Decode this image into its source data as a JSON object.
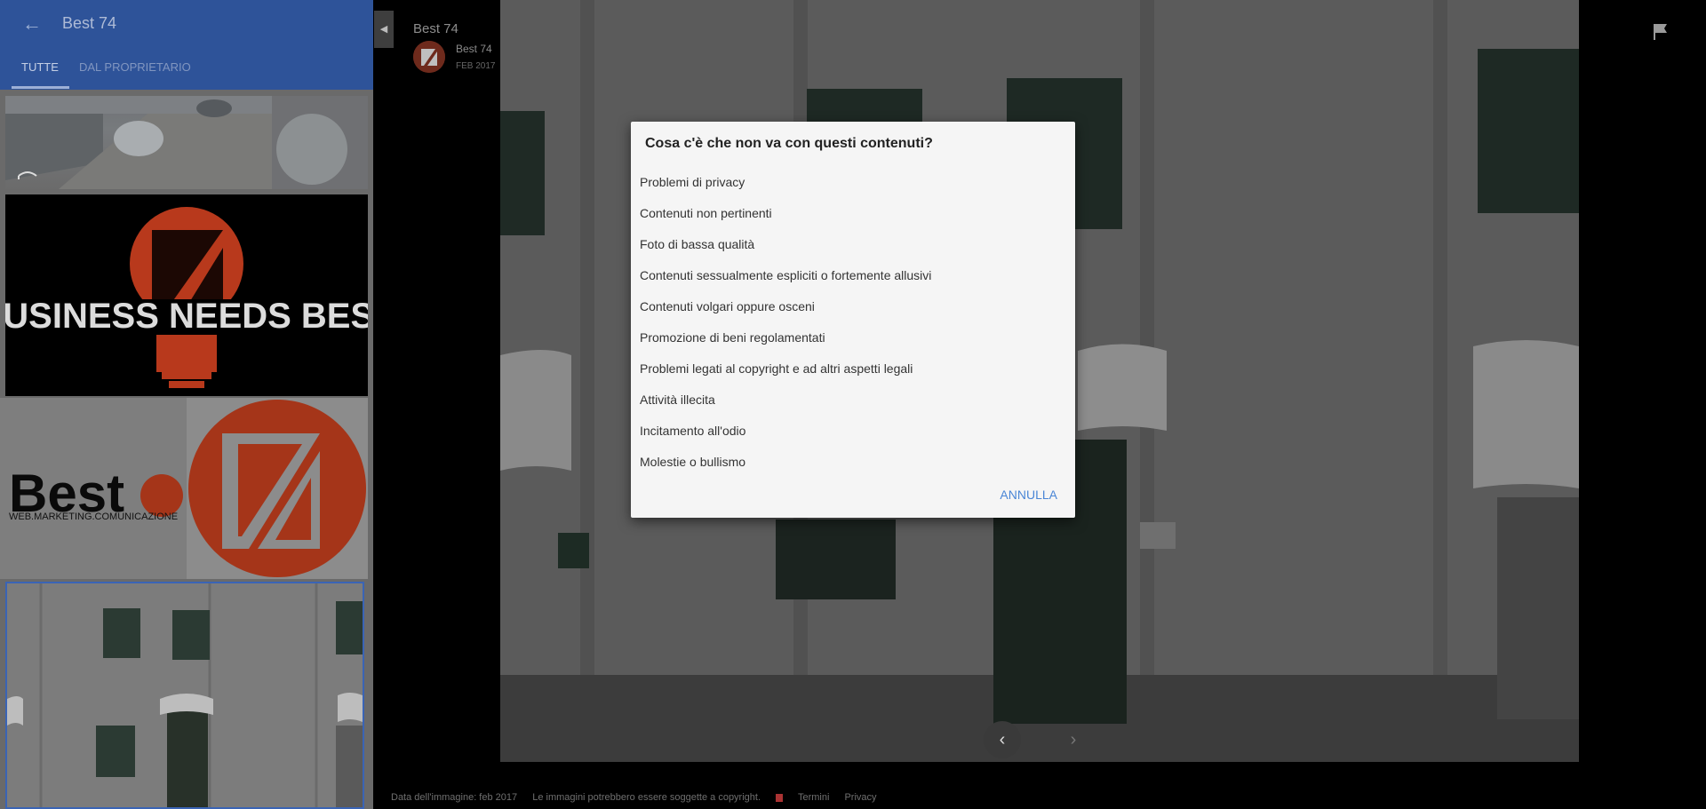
{
  "sidebar": {
    "title": "Best 74",
    "tabs": [
      {
        "label": "TUTTE",
        "active": true
      },
      {
        "label": "DAL PROPRIETARIO",
        "active": false
      }
    ],
    "thumbnails": [
      {
        "kind": "street-view-photo"
      },
      {
        "kind": "logo-business-needs-best",
        "text": "BUSINESS NEEDS BEST"
      },
      {
        "kind": "logo-best74",
        "brand": "Best",
        "tagline": "WEB.MARKETING.COMUNICAZIONE"
      },
      {
        "kind": "building-photo",
        "selected": true
      }
    ]
  },
  "viewer": {
    "title": "Best 74",
    "author": {
      "name": "Best 74",
      "date": "FEB 2017"
    },
    "footer": {
      "image_date": "Data dell'immagine: feb 2017",
      "copyright": "Le immagini potrebbero essere soggette a copyright.",
      "terms": "Termini",
      "privacy": "Privacy"
    },
    "nav": {
      "prev": "‹",
      "next": "›"
    }
  },
  "dialog": {
    "title": "Cosa c'è che non va con questi contenuti?",
    "options": [
      "Problemi di privacy",
      "Contenuti non pertinenti",
      "Foto di bassa qualità",
      "Contenuti sessualmente espliciti o fortemente allusivi",
      "Contenuti volgari oppure osceni",
      "Promozione di beni regolamentati",
      "Problemi legati al copyright e ad altri aspetti legali",
      "Attività illecita",
      "Incitamento all'odio",
      "Molestie o bullismo"
    ],
    "cancel_label": "ANNULLA"
  },
  "colors": {
    "header_blue": "#2e5399",
    "logo_orange": "#b8391c",
    "accent_link": "#4a86d6"
  }
}
